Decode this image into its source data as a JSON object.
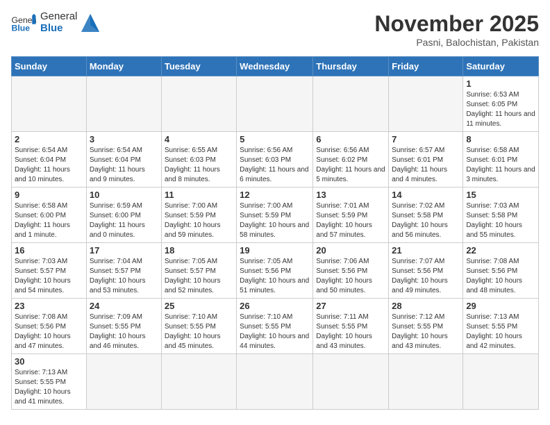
{
  "header": {
    "logo_general": "General",
    "logo_blue": "Blue",
    "month_title": "November 2025",
    "subtitle": "Pasni, Balochistan, Pakistan"
  },
  "weekdays": [
    "Sunday",
    "Monday",
    "Tuesday",
    "Wednesday",
    "Thursday",
    "Friday",
    "Saturday"
  ],
  "days": {
    "1": {
      "sunrise": "6:53 AM",
      "sunset": "6:05 PM",
      "daylight": "11 hours and 11 minutes."
    },
    "2": {
      "sunrise": "6:54 AM",
      "sunset": "6:04 PM",
      "daylight": "11 hours and 10 minutes."
    },
    "3": {
      "sunrise": "6:54 AM",
      "sunset": "6:04 PM",
      "daylight": "11 hours and 9 minutes."
    },
    "4": {
      "sunrise": "6:55 AM",
      "sunset": "6:03 PM",
      "daylight": "11 hours and 8 minutes."
    },
    "5": {
      "sunrise": "6:56 AM",
      "sunset": "6:03 PM",
      "daylight": "11 hours and 6 minutes."
    },
    "6": {
      "sunrise": "6:56 AM",
      "sunset": "6:02 PM",
      "daylight": "11 hours and 5 minutes."
    },
    "7": {
      "sunrise": "6:57 AM",
      "sunset": "6:01 PM",
      "daylight": "11 hours and 4 minutes."
    },
    "8": {
      "sunrise": "6:58 AM",
      "sunset": "6:01 PM",
      "daylight": "11 hours and 3 minutes."
    },
    "9": {
      "sunrise": "6:58 AM",
      "sunset": "6:00 PM",
      "daylight": "11 hours and 1 minute."
    },
    "10": {
      "sunrise": "6:59 AM",
      "sunset": "6:00 PM",
      "daylight": "11 hours and 0 minutes."
    },
    "11": {
      "sunrise": "7:00 AM",
      "sunset": "5:59 PM",
      "daylight": "10 hours and 59 minutes."
    },
    "12": {
      "sunrise": "7:00 AM",
      "sunset": "5:59 PM",
      "daylight": "10 hours and 58 minutes."
    },
    "13": {
      "sunrise": "7:01 AM",
      "sunset": "5:59 PM",
      "daylight": "10 hours and 57 minutes."
    },
    "14": {
      "sunrise": "7:02 AM",
      "sunset": "5:58 PM",
      "daylight": "10 hours and 56 minutes."
    },
    "15": {
      "sunrise": "7:03 AM",
      "sunset": "5:58 PM",
      "daylight": "10 hours and 55 minutes."
    },
    "16": {
      "sunrise": "7:03 AM",
      "sunset": "5:57 PM",
      "daylight": "10 hours and 54 minutes."
    },
    "17": {
      "sunrise": "7:04 AM",
      "sunset": "5:57 PM",
      "daylight": "10 hours and 53 minutes."
    },
    "18": {
      "sunrise": "7:05 AM",
      "sunset": "5:57 PM",
      "daylight": "10 hours and 52 minutes."
    },
    "19": {
      "sunrise": "7:05 AM",
      "sunset": "5:56 PM",
      "daylight": "10 hours and 51 minutes."
    },
    "20": {
      "sunrise": "7:06 AM",
      "sunset": "5:56 PM",
      "daylight": "10 hours and 50 minutes."
    },
    "21": {
      "sunrise": "7:07 AM",
      "sunset": "5:56 PM",
      "daylight": "10 hours and 49 minutes."
    },
    "22": {
      "sunrise": "7:08 AM",
      "sunset": "5:56 PM",
      "daylight": "10 hours and 48 minutes."
    },
    "23": {
      "sunrise": "7:08 AM",
      "sunset": "5:56 PM",
      "daylight": "10 hours and 47 minutes."
    },
    "24": {
      "sunrise": "7:09 AM",
      "sunset": "5:55 PM",
      "daylight": "10 hours and 46 minutes."
    },
    "25": {
      "sunrise": "7:10 AM",
      "sunset": "5:55 PM",
      "daylight": "10 hours and 45 minutes."
    },
    "26": {
      "sunrise": "7:10 AM",
      "sunset": "5:55 PM",
      "daylight": "10 hours and 44 minutes."
    },
    "27": {
      "sunrise": "7:11 AM",
      "sunset": "5:55 PM",
      "daylight": "10 hours and 43 minutes."
    },
    "28": {
      "sunrise": "7:12 AM",
      "sunset": "5:55 PM",
      "daylight": "10 hours and 43 minutes."
    },
    "29": {
      "sunrise": "7:13 AM",
      "sunset": "5:55 PM",
      "daylight": "10 hours and 42 minutes."
    },
    "30": {
      "sunrise": "7:13 AM",
      "sunset": "5:55 PM",
      "daylight": "10 hours and 41 minutes."
    }
  }
}
